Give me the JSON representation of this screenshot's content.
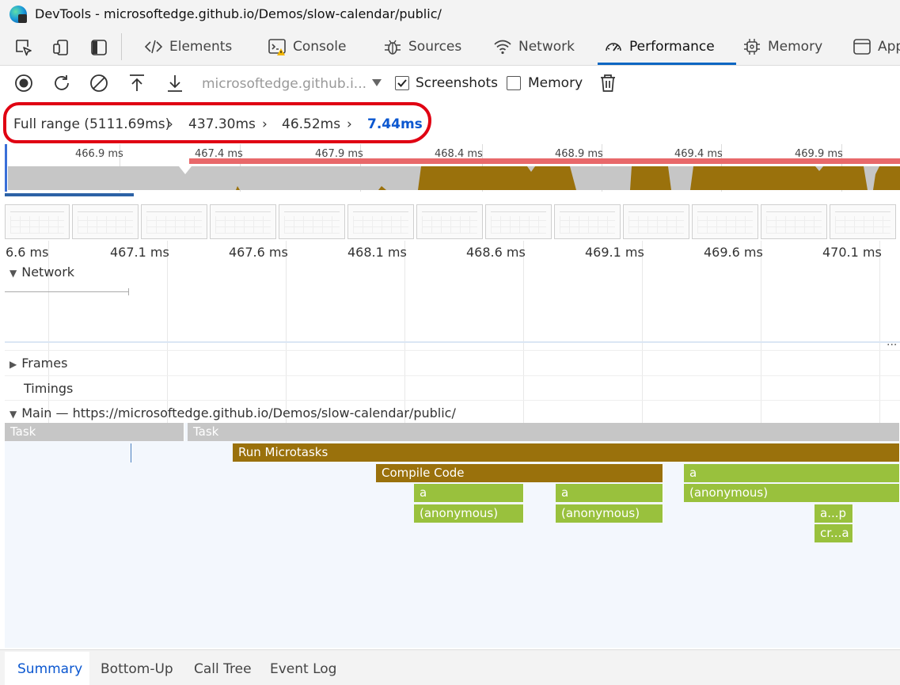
{
  "window": {
    "title": "DevTools - microsoftedge.github.io/Demos/slow-calendar/public/"
  },
  "tabs": [
    {
      "label": "Elements",
      "icon": "code-brackets-icon"
    },
    {
      "label": "Console",
      "icon": "console-warning-icon"
    },
    {
      "label": "Sources",
      "icon": "bug-icon"
    },
    {
      "label": "Network",
      "icon": "wifi-icon"
    },
    {
      "label": "Performance",
      "icon": "speedometer-icon",
      "active": true
    },
    {
      "label": "Memory",
      "icon": "chip-icon"
    },
    {
      "label": "App",
      "icon": "app-window-icon"
    }
  ],
  "toolbar": {
    "profile_select": "microsoftedge.github.i...",
    "screenshots_label": "Screenshots",
    "screenshots_checked": true,
    "memory_label": "Memory",
    "memory_checked": false
  },
  "breadcrumb": {
    "items": [
      "Full range (5111.69ms)",
      "437.30ms",
      "46.52ms",
      "7.44ms"
    ]
  },
  "overview": {
    "ticks": [
      "466.9 ms",
      "467.4 ms",
      "467.9 ms",
      "468.4 ms",
      "468.9 ms",
      "469.4 ms",
      "469.9 ms"
    ]
  },
  "ruler": {
    "ticks": [
      "6.6 ms",
      "467.1 ms",
      "467.6 ms",
      "468.1 ms",
      "468.6 ms",
      "469.1 ms",
      "469.6 ms",
      "470.1 ms"
    ]
  },
  "tracks": {
    "network": "Network",
    "frames": "Frames",
    "timings": "Timings",
    "main": "Main — https://microsoftedge.github.io/Demos/slow-calendar/public/",
    "more": "..."
  },
  "flame": [
    {
      "name": "Task",
      "level": 0,
      "color": "task"
    },
    {
      "name": "Task",
      "level": 0,
      "color": "task"
    },
    {
      "name": "Run Microtasks",
      "level": 1,
      "color": "brown"
    },
    {
      "name": "Compile Code",
      "level": 2,
      "color": "brown"
    },
    {
      "name": "a",
      "level": 2,
      "color": "green"
    },
    {
      "name": "a",
      "level": 3,
      "color": "green"
    },
    {
      "name": "a",
      "level": 3,
      "color": "green"
    },
    {
      "name": "(anonymous)",
      "level": 3,
      "color": "green"
    },
    {
      "name": "(anonymous)",
      "level": 4,
      "color": "green"
    },
    {
      "name": "(anonymous)",
      "level": 4,
      "color": "green"
    },
    {
      "name": "a...p",
      "level": 4,
      "color": "green"
    },
    {
      "name": "cr...a",
      "level": 5,
      "color": "green"
    }
  ],
  "bottom_tabs": [
    {
      "label": "Summary",
      "active": true
    },
    {
      "label": "Bottom-Up"
    },
    {
      "label": "Call Tree"
    },
    {
      "label": "Event Log"
    }
  ],
  "colors": {
    "accent": "#0a66c2",
    "task": "#c6c6c6",
    "brown": "#9a710c",
    "green": "#99c13d",
    "annotation": "#e00012"
  }
}
